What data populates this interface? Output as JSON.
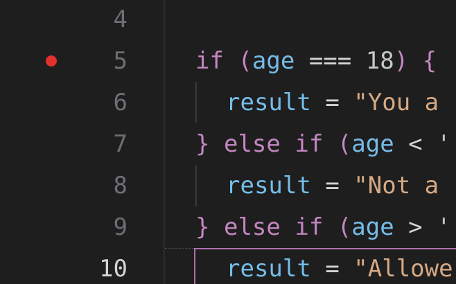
{
  "editor": {
    "lines": [
      {
        "number": "4"
      },
      {
        "number": "5",
        "breakpoint": true,
        "tokens": [
          "if",
          "(",
          "age",
          "===",
          "18",
          ")",
          "{"
        ]
      },
      {
        "number": "6",
        "tokens": [
          "result",
          "=",
          "\"You a"
        ]
      },
      {
        "number": "7",
        "tokens": [
          "}",
          "else",
          "if",
          "(",
          "age",
          "<",
          "'"
        ]
      },
      {
        "number": "8",
        "tokens": [
          "result",
          "=",
          "\"Not a"
        ]
      },
      {
        "number": "9",
        "tokens": [
          "}",
          "else",
          "if",
          "(",
          "age",
          ">",
          "'"
        ]
      },
      {
        "number": "10",
        "active": true,
        "tokens": [
          "result",
          "=",
          "\"Allowe"
        ]
      }
    ]
  },
  "colors": {
    "background": "#1e1e1f",
    "keyword": "#c586c0",
    "variable": "#75bde8",
    "string": "#d6a984",
    "breakpoint": "#e0322c",
    "line_highlight_border": "#b16fb0"
  }
}
